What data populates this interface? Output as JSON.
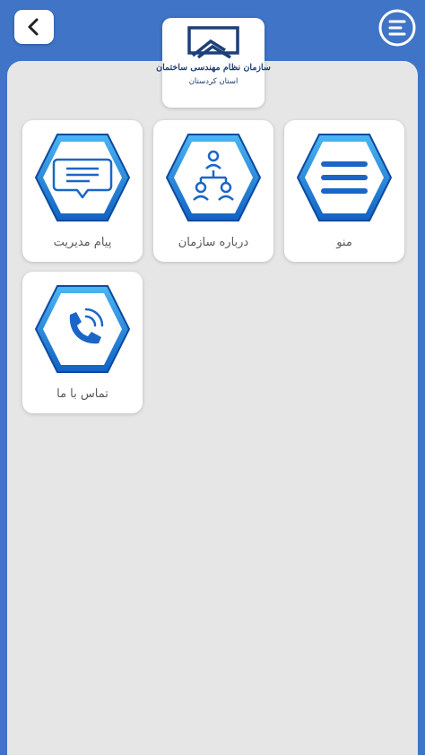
{
  "header": {
    "back_icon": "chevron-left-icon",
    "menu_icon": "menu-list-icon",
    "colors": {
      "background": "#3f74c6",
      "panel": "#e6e6e6"
    }
  },
  "logo": {
    "title": "سازمان نظام مهندسی ساختمان",
    "subtitle": "استان کردستان",
    "icon": "building-logo-icon"
  },
  "tiles": [
    {
      "label": "منو",
      "icon": "list-lines-icon"
    },
    {
      "label": "درباره سازمان",
      "icon": "org-chart-icon"
    },
    {
      "label": "پیام مدیریت",
      "icon": "chat-bubble-icon"
    },
    {
      "label": "تماس با ما",
      "icon": "phone-call-icon"
    }
  ],
  "colors": {
    "hex_light": "#4cb6f2",
    "hex_dark": "#1262c4",
    "hex_edge": "#0b4aa0",
    "icon_fill": "#1a66c8"
  }
}
